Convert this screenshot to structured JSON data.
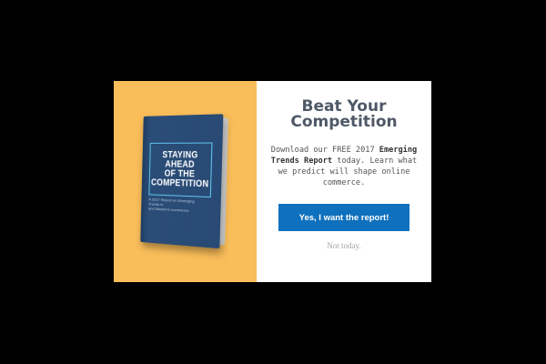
{
  "book": {
    "title": "STAYING\nAHEAD\nOF THE\nCOMPETITION",
    "subtitle": "A 2017 Report on Emerging Trends in\nand Market E-commerce"
  },
  "popup": {
    "headline": "Beat Your\nCompetition",
    "body_pre": "Download our FREE 2017 ",
    "body_bold": "Emerging Trends Report",
    "body_post": " today. Learn what we predict will shape online commerce.",
    "cta_label": "Yes, I want the report!",
    "dismiss_label": "Not today."
  },
  "colors": {
    "overlay": "#000000",
    "left_panel": "#f9bd59",
    "cta": "#0f70bd",
    "book_cover": "#284a74"
  }
}
